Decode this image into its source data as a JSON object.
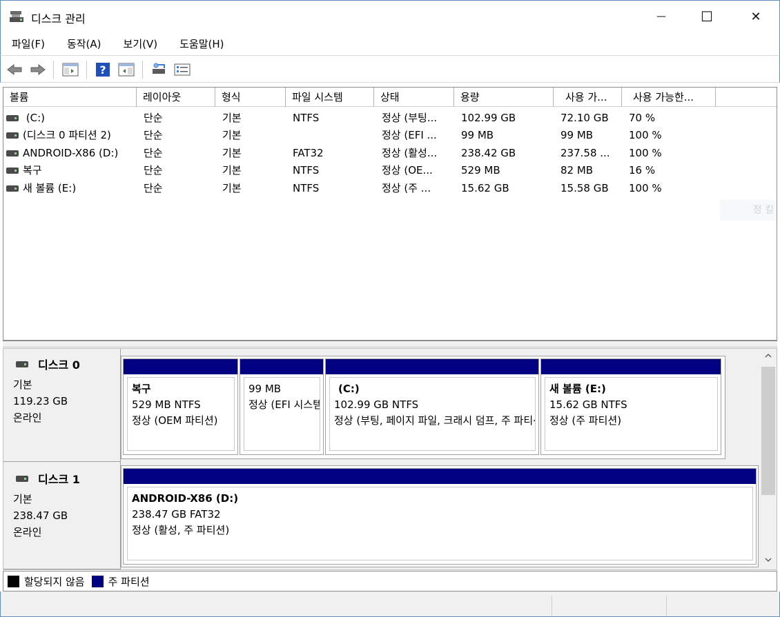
{
  "window": {
    "title": "디스크 관리",
    "minimize_glyph": "—",
    "maximize_glyph": "☐",
    "close_glyph": "✕"
  },
  "menu": [
    "파일(F)",
    "동작(A)",
    "보기(V)",
    "도움말(H)"
  ],
  "toolbar": {
    "icons": [
      "back-arrow-icon",
      "forward-arrow-icon",
      "console-tree-icon",
      "help-icon",
      "properties-panel-icon",
      "connect-disk-icon",
      "checklist-icon"
    ]
  },
  "volume_list": {
    "columns": [
      "볼륨",
      "레이아웃",
      "형식",
      "파일 시스템",
      "상태",
      "용량",
      "사용 가...",
      "사용 가능한..."
    ],
    "rows": [
      {
        "volume": " (C:)",
        "layout": "단순",
        "type": "기본",
        "fs": "NTFS",
        "status": "정상 (부팅...",
        "capacity": "102.99 GB",
        "free": "72.10 GB",
        "pct": "70 %"
      },
      {
        "volume": "(디스크 0 파티션 2)",
        "layout": "단순",
        "type": "기본",
        "fs": "",
        "status": "정상 (EFI ...",
        "capacity": "99 MB",
        "free": "99 MB",
        "pct": "100 %"
      },
      {
        "volume": "ANDROID-X86 (D:)",
        "layout": "단순",
        "type": "기본",
        "fs": "FAT32",
        "status": "정상 (활성...",
        "capacity": "238.42 GB",
        "free": "237.58 ...",
        "pct": "100 %"
      },
      {
        "volume": "복구",
        "layout": "단순",
        "type": "기본",
        "fs": "NTFS",
        "status": "정상 (OE...",
        "capacity": "529 MB",
        "free": "82 MB",
        "pct": "16 %"
      },
      {
        "volume": "새 볼륨 (E:)",
        "layout": "단순",
        "type": "기본",
        "fs": "NTFS",
        "status": "정상 (주 ...",
        "capacity": "15.62 GB",
        "free": "15.58 GB",
        "pct": "100 %"
      }
    ],
    "ghost_text": "정 킬"
  },
  "disks": [
    {
      "name": "디스크 0",
      "kind": "기본",
      "size": "119.23 GB",
      "state": "온라인",
      "partitions": [
        {
          "name": "복구",
          "size_fs": "529 MB NTFS",
          "status": "정상 (OEM 파티션)"
        },
        {
          "name": "",
          "size_fs": "99 MB",
          "status": "정상 (EFI 시스템 파티션)"
        },
        {
          "name": "(C:)",
          "size_fs": "102.99 GB NTFS",
          "status": "정상 (부팅, 페이지 파일, 크래시 덤프, 주 파티션)"
        },
        {
          "name": "새 볼륨  (E:)",
          "size_fs": "15.62 GB NTFS",
          "status": "정상 (주 파티션)"
        }
      ]
    },
    {
      "name": "디스크 1",
      "kind": "기본",
      "size": "238.47 GB",
      "state": "온라인",
      "partitions": [
        {
          "name": "ANDROID-X86  (D:)",
          "size_fs": "238.47 GB FAT32",
          "status": "정상 (활성, 주 파티션)"
        }
      ]
    }
  ],
  "legend": [
    {
      "label": "할당되지 않음",
      "color": "#000000"
    },
    {
      "label": "주 파티션",
      "color": "#000080"
    }
  ],
  "colors": {
    "primary_partition": "#000080",
    "unallocated": "#000000",
    "window_border": "#5a8fc5"
  }
}
